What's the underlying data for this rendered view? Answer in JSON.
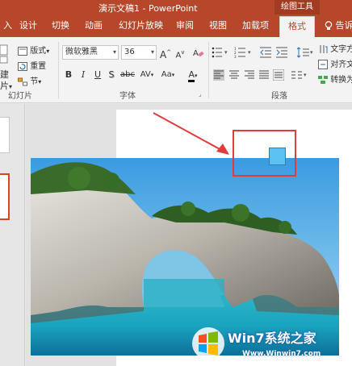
{
  "window": {
    "title": "演示文稿1 - PowerPoint",
    "context_tab_group": "绘图工具"
  },
  "tabs": [
    {
      "label": "入"
    },
    {
      "label": "设计"
    },
    {
      "label": "切换"
    },
    {
      "label": "动画"
    },
    {
      "label": "幻灯片放映"
    },
    {
      "label": "审阅"
    },
    {
      "label": "视图"
    },
    {
      "label": "加载项"
    },
    {
      "label": "格式",
      "active": true
    }
  ],
  "tell_me": "告诉",
  "ribbon": {
    "slides_group": {
      "new_slide_partial": "建",
      "slide_partial": "片",
      "layout": "版式",
      "reset": "重置",
      "section": "节",
      "label": "幻灯片"
    },
    "font_group": {
      "font_name": "微软雅黑",
      "font_size": "36",
      "bold": "B",
      "italic": "I",
      "underline": "U",
      "shadow": "S",
      "strike": "abc",
      "spacing": "AV",
      "change_case": "Aa",
      "font_color": "A",
      "grow": "A",
      "shrink": "A",
      "label": "字体"
    },
    "paragraph_group": {
      "text_direction": "文字方",
      "align_text": "对齐文",
      "convert": "转换为",
      "label": "段落"
    }
  },
  "watermark": {
    "brand_main": "Win7系统之家",
    "url": "Www.Winwin7.com"
  },
  "colors": {
    "accent": "#b7472a",
    "highlight_box": "#e23b3b",
    "selected_shape": "#5bc0f2"
  }
}
